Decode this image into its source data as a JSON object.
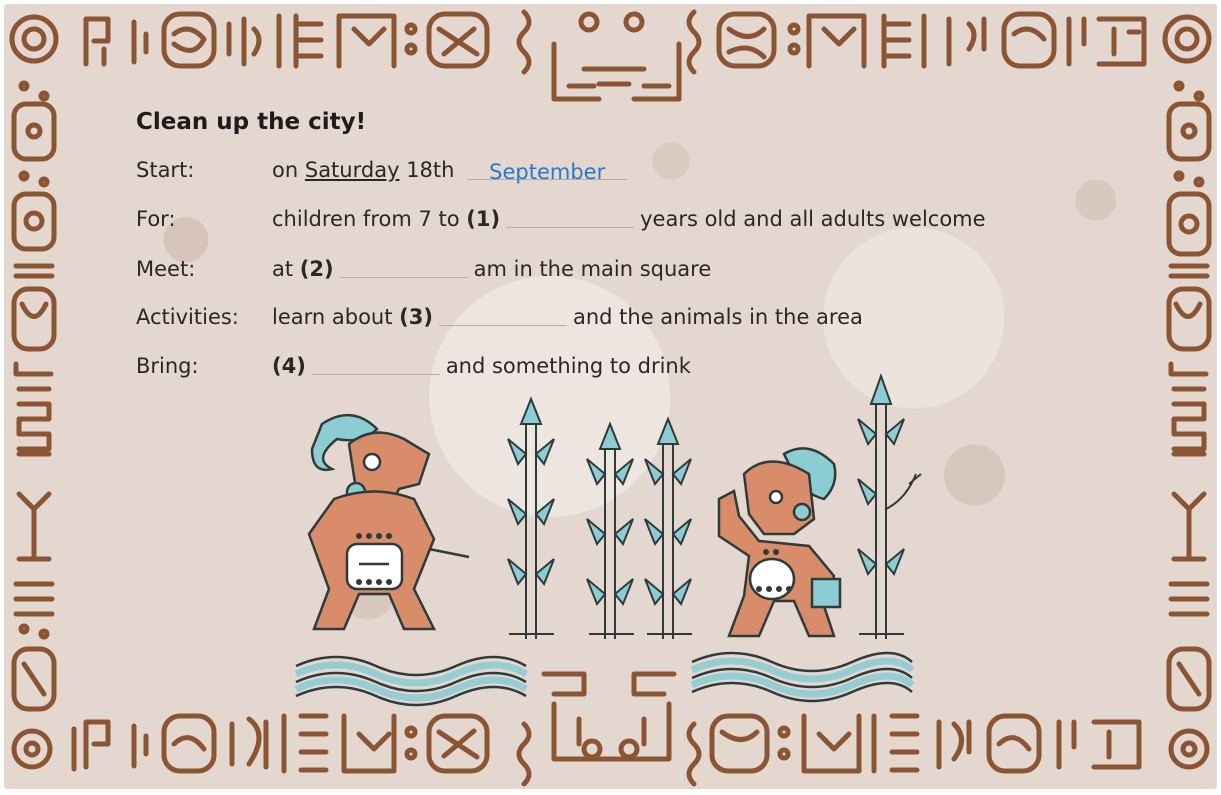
{
  "poster": {
    "title": "Clean up the city!",
    "rows": [
      {
        "label": "Start:",
        "parts": {
          "pre": "on",
          "underlined": "Saturday",
          "mid": "18th",
          "answer": "September"
        }
      },
      {
        "label": "For:",
        "parts": {
          "pre": "children from 7 to",
          "num": "(1)",
          "post": "years old and all adults welcome"
        }
      },
      {
        "label": "Meet:",
        "parts": {
          "pre": "at",
          "num": "(2)",
          "post": "am in the main square"
        }
      },
      {
        "label": "Activities:",
        "parts": {
          "pre": "learn about",
          "num": "(3)",
          "post": "and the animals in the area"
        }
      },
      {
        "label": "Bring:",
        "parts": {
          "num": "(4)",
          "post": "and something to drink"
        }
      }
    ]
  },
  "colors": {
    "paper": "#e4d7cf",
    "border_brown": "#8b5433",
    "answer_blue": "#2a79c8",
    "figure_orange": "#d98c6a",
    "teal": "#8ccdd3"
  }
}
